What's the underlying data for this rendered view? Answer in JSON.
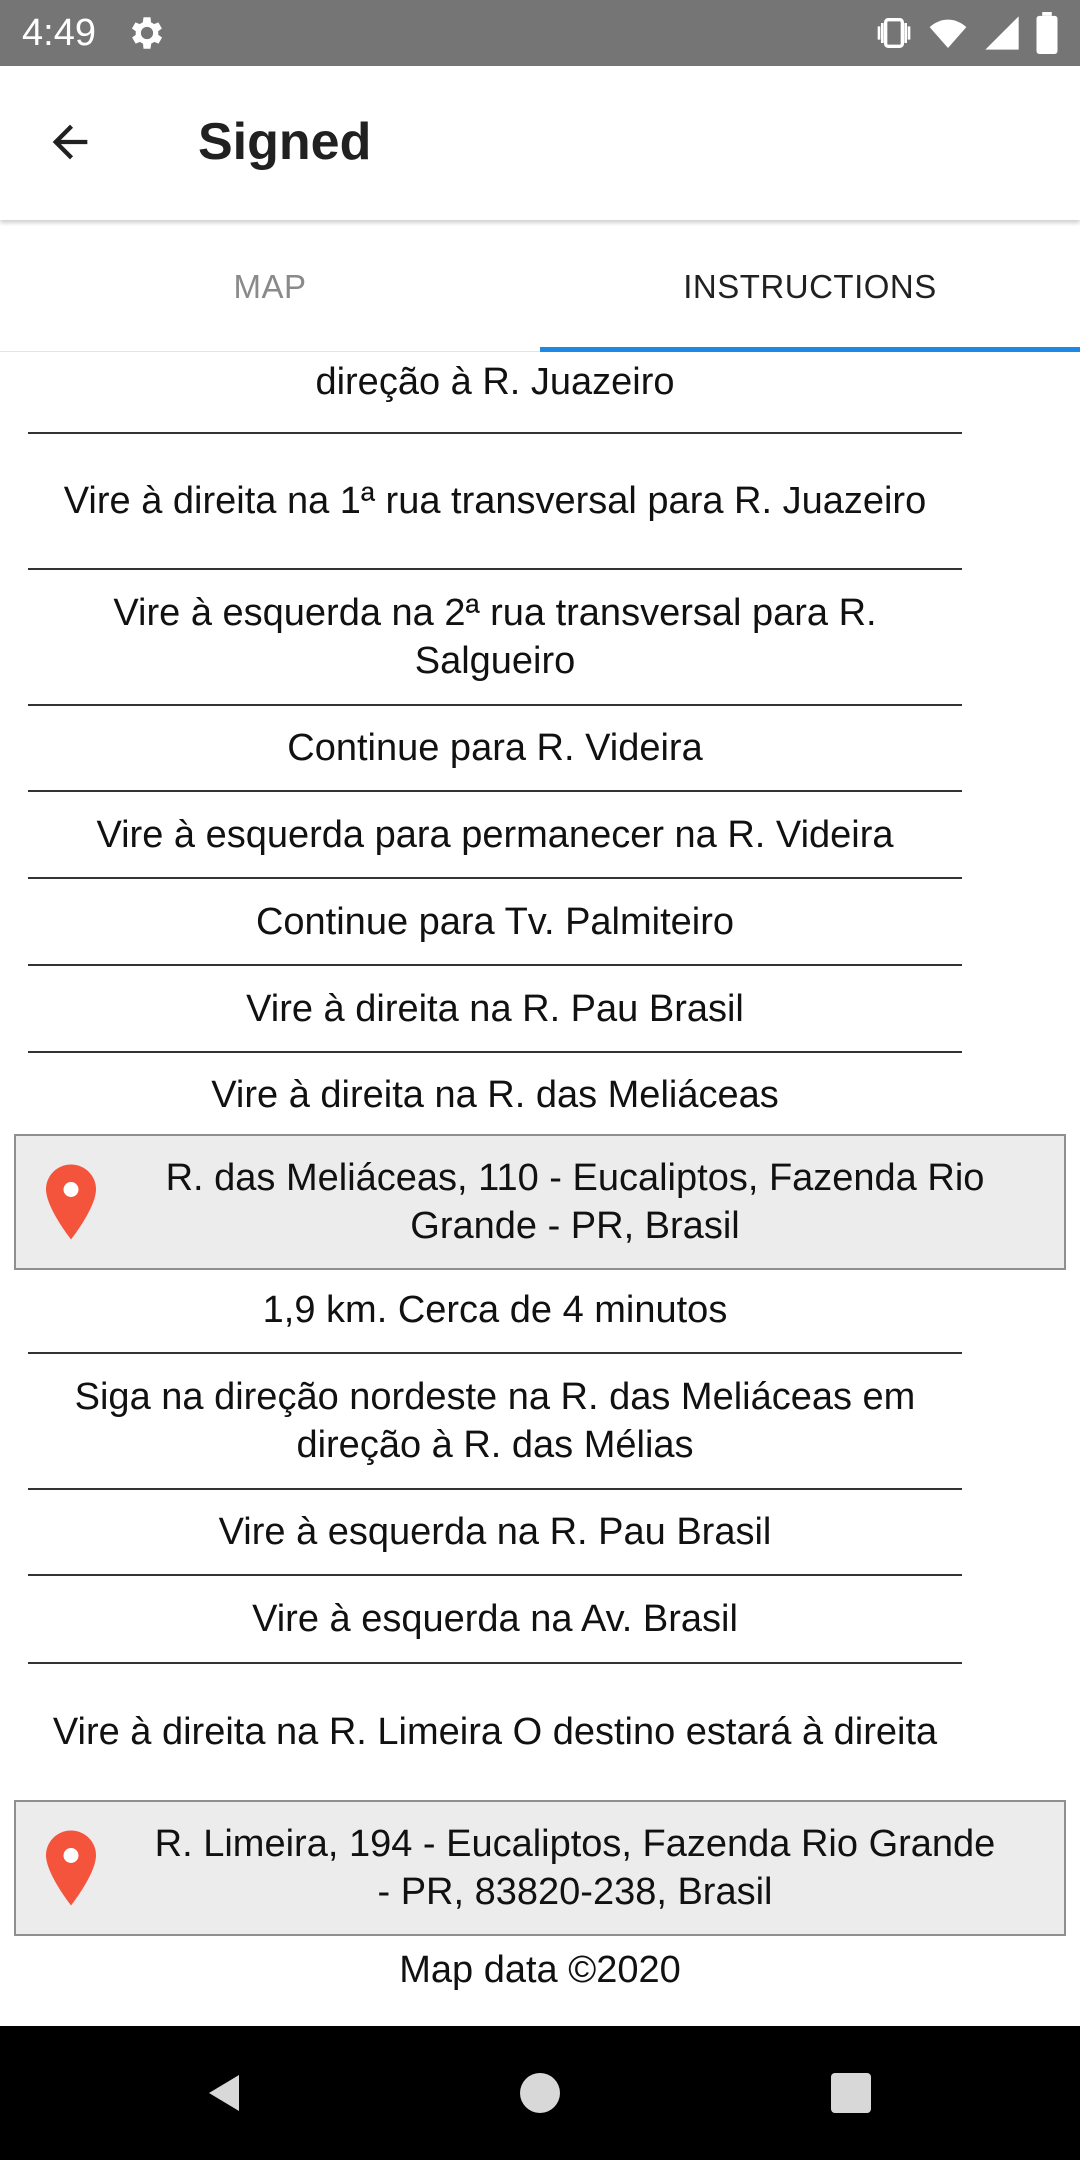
{
  "status_bar": {
    "time": "4:49"
  },
  "app_bar": {
    "title": "Signed"
  },
  "tabs": [
    {
      "label": "MAP",
      "selected": false
    },
    {
      "label": "INSTRUCTIONS",
      "selected": true
    }
  ],
  "instructions": {
    "leg1_steps": [
      "direção à  R. Juazeiro",
      "Vire à  direita  na 1ª rua transversal para  R. Juazeiro",
      "Vire à  esquerda  na 2ª rua transversal para  R. Salgueiro",
      "Continue para  R. Videira",
      "Vire à  esquerda  para permanecer na  R. Videira",
      "Continue para  Tv. Palmiteiro",
      "Vire à  direita  na  R. Pau Brasil",
      "Vire à  direita  na  R. das Meliáceas"
    ],
    "waypoint_1": {
      "address": "R. das Meliáceas, 110 - Eucaliptos, Fazenda Rio Grande - PR, Brasil",
      "icon": "map-pin-icon"
    },
    "leg2_summary": "1,9 km. Cerca de 4 minutos",
    "leg2_steps": [
      "Siga na direção  nordeste  na  R. das Meliáceas em direção à  R. das Mélias",
      "Vire à  esquerda  na  R. Pau Brasil",
      "Vire à  esquerda  na  Av. Brasil",
      "Vire à  direita  na  R. Limeira  O destino estará à direita"
    ],
    "destination": {
      "address": "R. Limeira, 194 - Eucaliptos, Fazenda Rio Grande - PR, 83820-238, Brasil",
      "icon": "map-pin-icon"
    },
    "map_data_note": "Map data ©2020"
  },
  "colors": {
    "status_bar": "#757575",
    "tab_indicator": "#1e88e5",
    "pin": "#f4533c",
    "card_bg": "#ececec"
  }
}
